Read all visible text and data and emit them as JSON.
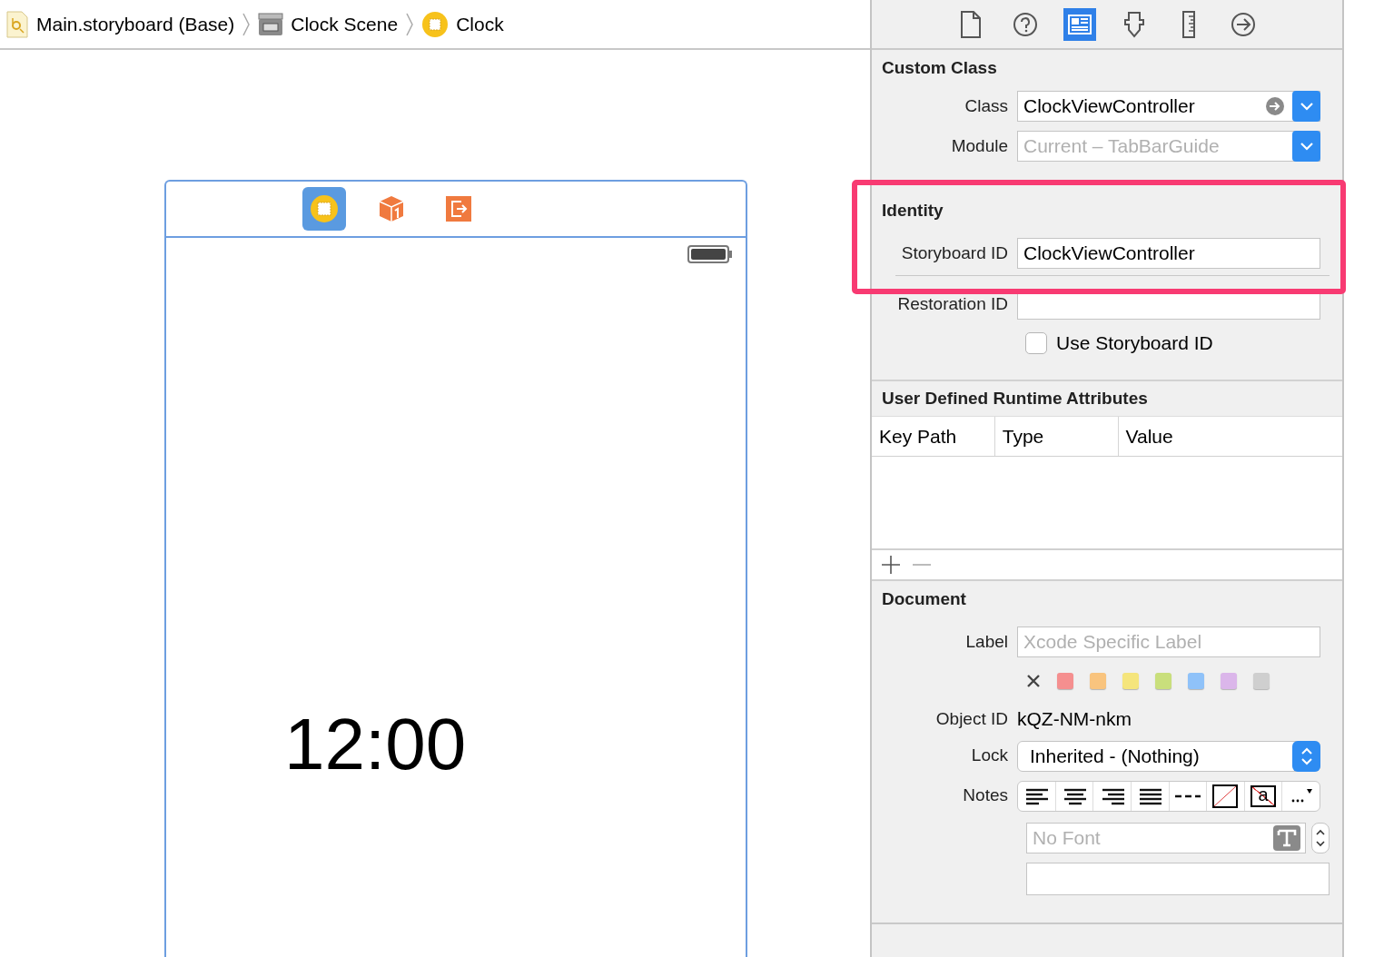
{
  "breadcrumb": [
    {
      "kind": "storyboard",
      "label": "Main.storyboard (Base)"
    },
    {
      "kind": "scene",
      "label": "Clock Scene"
    },
    {
      "kind": "controller",
      "label": "Clock"
    }
  ],
  "inspector_tabs": [
    {
      "kind": "file",
      "selected": false
    },
    {
      "kind": "help",
      "selected": false
    },
    {
      "kind": "identity",
      "selected": true
    },
    {
      "kind": "attributes",
      "selected": false
    },
    {
      "kind": "size",
      "selected": false
    },
    {
      "kind": "connections",
      "selected": false
    }
  ],
  "scene": {
    "dock": [
      {
        "kind": "controller",
        "selected": true
      },
      {
        "kind": "first-responder",
        "selected": false
      },
      {
        "kind": "exit",
        "selected": false
      }
    ],
    "time": "12:00"
  },
  "custom_class": {
    "title": "Custom Class",
    "class_label": "Class",
    "class_value": "ClockViewController",
    "module_label": "Module",
    "module_placeholder": "Current – TabBarGuide"
  },
  "identity": {
    "title": "Identity",
    "highlighted": true,
    "storyboard_id_label": "Storyboard ID",
    "storyboard_id": "ClockViewController",
    "restoration_id_label": "Restoration ID",
    "use_storyboard_id_label": "Use Storyboard ID",
    "use_storyboard_id_checked": false
  },
  "runtime_attributes": {
    "title": "User Defined Runtime Attributes",
    "columns": [
      "Key Path",
      "Type",
      "Value"
    ]
  },
  "document": {
    "title": "Document",
    "label_label": "Label",
    "label_placeholder": "Xcode Specific Label",
    "colors": [
      {
        "kind": "none"
      },
      {
        "kind": "swatch",
        "color": "#f58f8f"
      },
      {
        "kind": "swatch",
        "color": "#f9c47e"
      },
      {
        "kind": "swatch",
        "color": "#f5e57c"
      },
      {
        "kind": "swatch",
        "color": "#c9df7c"
      },
      {
        "kind": "swatch",
        "color": "#8fc2f9"
      },
      {
        "kind": "swatch",
        "color": "#dbb6ea"
      },
      {
        "kind": "swatch",
        "color": "#cfcfcf"
      }
    ],
    "object_id_label": "Object ID",
    "object_id": "kQZ-NM-nkm",
    "lock_label": "Lock",
    "lock_value": "Inherited - (Nothing)",
    "notes_label": "Notes",
    "notes_tools": [
      {
        "kind": "align-left"
      },
      {
        "kind": "align-center"
      },
      {
        "kind": "align-right"
      },
      {
        "kind": "justify"
      },
      {
        "kind": "dashes"
      },
      {
        "kind": "no-fill"
      },
      {
        "kind": "text-color",
        "glyph": "a"
      },
      {
        "kind": "more"
      }
    ],
    "font_placeholder": "No Font"
  }
}
